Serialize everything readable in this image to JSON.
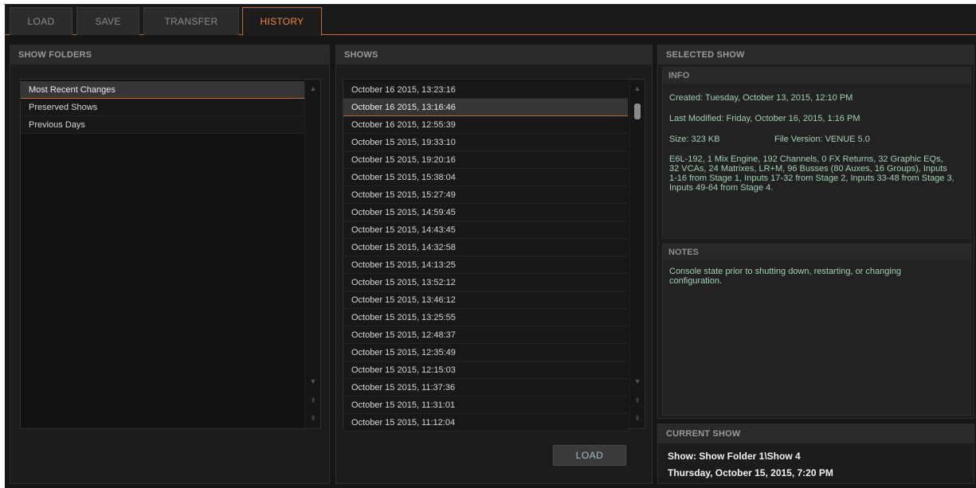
{
  "tabs": [
    {
      "label": "LOAD"
    },
    {
      "label": "SAVE"
    },
    {
      "label": "TRANSFER"
    },
    {
      "label": "HISTORY"
    }
  ],
  "active_tab": "HISTORY",
  "show_folders": {
    "title": "SHOW FOLDERS",
    "items": [
      "Most Recent Changes",
      "Preserved Shows",
      "Previous Days"
    ],
    "selected_index": 0
  },
  "shows": {
    "title": "SHOWS",
    "items": [
      "October 16 2015, 13:23:16",
      "October 16 2015, 13:16:46",
      "October 16 2015, 12:55:39",
      "October 15 2015, 19:33:10",
      "October 15 2015, 19:20:16",
      "October 15 2015, 15:38:04",
      "October 15 2015, 15:27:49",
      "October 15 2015, 14:59:45",
      "October 15 2015, 14:43:45",
      "October 15 2015, 14:32:58",
      "October 15 2015, 14:13:25",
      "October 15 2015, 13:52:12",
      "October 15 2015, 13:46:12",
      "October 15 2015, 13:25:55",
      "October 15 2015, 12:48:37",
      "October 15 2015, 12:35:49",
      "October 15 2015, 12:15:03",
      "October 15 2015, 11:37:36",
      "October 15 2015, 11:31:01",
      "October 15 2015, 11:12:04"
    ],
    "selected_index": 1,
    "load_label": "LOAD"
  },
  "selected_show": {
    "title": "SELECTED SHOW",
    "info": {
      "title": "INFO",
      "created": "Created: Tuesday, October 13, 2015, 12:10 PM",
      "modified": "Last Modified: Friday, October 16, 2015, 1:16 PM",
      "size": "Size: 323 KB",
      "version": "File Version: VENUE 5.0",
      "config_lines": [
        "E6L-192, 1 Mix Engine, 192 Channels, 0 FX Returns, 32 Graphic EQs,",
        "32 VCAs, 24 Matrixes, LR+M, 96 Busses (80 Auxes, 16 Groups), Inputs",
        "1-16 from Stage 1, Inputs 17-32 from Stage 2, Inputs 33-48 from Stage 3,",
        "Inputs 49-64 from Stage 4."
      ]
    },
    "notes": {
      "title": "NOTES",
      "lines": [
        "Console state prior to shutting down, restarting, or changing",
        "configuration."
      ]
    }
  },
  "current_show": {
    "title": "CURRENT SHOW",
    "show": "Show: Show Folder 1\\Show 4",
    "date": "Thursday, October 15, 2015, 7:20 PM"
  },
  "colors": {
    "accent": "#ee8a2e",
    "info_text": "#9fd2b2",
    "selected_row_border": "#c16a2a"
  },
  "icons": {
    "scroll_up": "triangle-up",
    "scroll_down": "triangle-down",
    "page_up": "double-chevron-up",
    "page_down": "double-chevron-down"
  }
}
